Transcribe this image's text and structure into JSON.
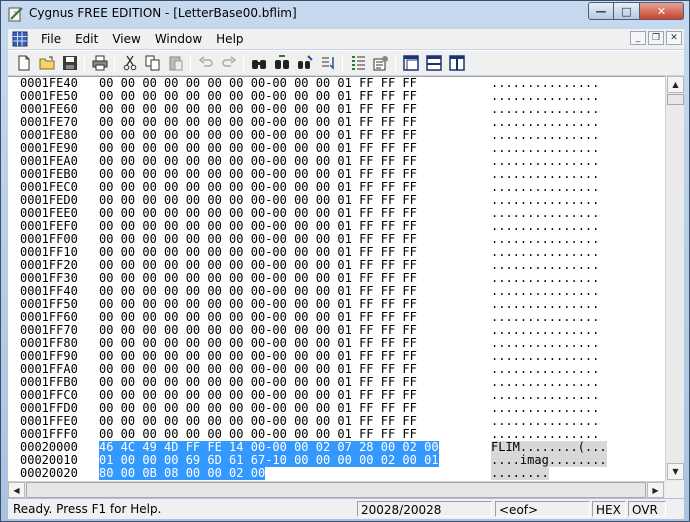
{
  "window": {
    "title": "Cygnus FREE EDITION - [LetterBase00.bflim]",
    "minimize_glyph": "—",
    "maximize_glyph": "□",
    "close_glyph": "✕"
  },
  "menu": {
    "items": [
      "File",
      "Edit",
      "View",
      "Window",
      "Help"
    ]
  },
  "mdi_controls": {
    "minimize": "_",
    "restore": "❐",
    "close": "✕"
  },
  "toolbar": {
    "icons": [
      "new-file-icon",
      "open-folder-icon",
      "save-icon",
      "print-icon",
      "cut-icon",
      "copy-icon",
      "paste-icon",
      "undo-icon",
      "redo-icon",
      "find-icon",
      "find-next-icon",
      "replace-icon",
      "goto-icon",
      "properties-icon",
      "options-icon",
      "tile-horizontal-icon",
      "tile-split-icon",
      "tile-vertical-icon"
    ]
  },
  "hex_rows": [
    {
      "addr": "0001FE40",
      "hex": "00 00 00 00 00 00 00 00-00 00 00 01 FF FF FF",
      "ascii": "..............."
    },
    {
      "addr": "0001FE50",
      "hex": "00 00 00 00 00 00 00 00-00 00 00 01 FF FF FF",
      "ascii": "..............."
    },
    {
      "addr": "0001FE60",
      "hex": "00 00 00 00 00 00 00 00-00 00 00 01 FF FF FF",
      "ascii": "..............."
    },
    {
      "addr": "0001FE70",
      "hex": "00 00 00 00 00 00 00 00-00 00 00 01 FF FF FF",
      "ascii": "..............."
    },
    {
      "addr": "0001FE80",
      "hex": "00 00 00 00 00 00 00 00-00 00 00 01 FF FF FF",
      "ascii": "..............."
    },
    {
      "addr": "0001FE90",
      "hex": "00 00 00 00 00 00 00 00-00 00 00 01 FF FF FF",
      "ascii": "..............."
    },
    {
      "addr": "0001FEA0",
      "hex": "00 00 00 00 00 00 00 00-00 00 00 01 FF FF FF",
      "ascii": "..............."
    },
    {
      "addr": "0001FEB0",
      "hex": "00 00 00 00 00 00 00 00-00 00 00 01 FF FF FF",
      "ascii": "..............."
    },
    {
      "addr": "0001FEC0",
      "hex": "00 00 00 00 00 00 00 00-00 00 00 01 FF FF FF",
      "ascii": "..............."
    },
    {
      "addr": "0001FED0",
      "hex": "00 00 00 00 00 00 00 00-00 00 00 01 FF FF FF",
      "ascii": "..............."
    },
    {
      "addr": "0001FEE0",
      "hex": "00 00 00 00 00 00 00 00-00 00 00 01 FF FF FF",
      "ascii": "..............."
    },
    {
      "addr": "0001FEF0",
      "hex": "00 00 00 00 00 00 00 00-00 00 00 01 FF FF FF",
      "ascii": "..............."
    },
    {
      "addr": "0001FF00",
      "hex": "00 00 00 00 00 00 00 00-00 00 00 01 FF FF FF",
      "ascii": "..............."
    },
    {
      "addr": "0001FF10",
      "hex": "00 00 00 00 00 00 00 00-00 00 00 01 FF FF FF",
      "ascii": "..............."
    },
    {
      "addr": "0001FF20",
      "hex": "00 00 00 00 00 00 00 00-00 00 00 01 FF FF FF",
      "ascii": "..............."
    },
    {
      "addr": "0001FF30",
      "hex": "00 00 00 00 00 00 00 00-00 00 00 01 FF FF FF",
      "ascii": "..............."
    },
    {
      "addr": "0001FF40",
      "hex": "00 00 00 00 00 00 00 00-00 00 00 01 FF FF FF",
      "ascii": "..............."
    },
    {
      "addr": "0001FF50",
      "hex": "00 00 00 00 00 00 00 00-00 00 00 01 FF FF FF",
      "ascii": "..............."
    },
    {
      "addr": "0001FF60",
      "hex": "00 00 00 00 00 00 00 00-00 00 00 01 FF FF FF",
      "ascii": "..............."
    },
    {
      "addr": "0001FF70",
      "hex": "00 00 00 00 00 00 00 00-00 00 00 01 FF FF FF",
      "ascii": "..............."
    },
    {
      "addr": "0001FF80",
      "hex": "00 00 00 00 00 00 00 00-00 00 00 01 FF FF FF",
      "ascii": "..............."
    },
    {
      "addr": "0001FF90",
      "hex": "00 00 00 00 00 00 00 00-00 00 00 01 FF FF FF",
      "ascii": "..............."
    },
    {
      "addr": "0001FFA0",
      "hex": "00 00 00 00 00 00 00 00-00 00 00 01 FF FF FF",
      "ascii": "..............."
    },
    {
      "addr": "0001FFB0",
      "hex": "00 00 00 00 00 00 00 00-00 00 00 01 FF FF FF",
      "ascii": "..............."
    },
    {
      "addr": "0001FFC0",
      "hex": "00 00 00 00 00 00 00 00-00 00 00 01 FF FF FF",
      "ascii": "..............."
    },
    {
      "addr": "0001FFD0",
      "hex": "00 00 00 00 00 00 00 00-00 00 00 01 FF FF FF",
      "ascii": "..............."
    },
    {
      "addr": "0001FFE0",
      "hex": "00 00 00 00 00 00 00 00-00 00 00 01 FF FF FF",
      "ascii": "..............."
    },
    {
      "addr": "0001FFF0",
      "hex": "00 00 00 00 00 00 00 00-00 00 00 01 FF FF FF",
      "ascii": "..............."
    },
    {
      "addr": "00020000",
      "hex": "46 4C 49 4D FF FE 14 00-00 00 02 07 28 00 02 00",
      "ascii": "FLIM........(...",
      "selected": true
    },
    {
      "addr": "00020010",
      "hex": "01 00 00 00 69 6D 61 67-10 00 00 00 00 02 00 01",
      "ascii": "....imag........",
      "selected": true
    },
    {
      "addr": "00020020",
      "hex": "80 00 0B 08 00 00 02 00",
      "ascii": "........",
      "selected": true
    }
  ],
  "scrollbars": {
    "up_arrow": "▲",
    "down_arrow": "▼",
    "left_arrow": "◀",
    "right_arrow": "▶"
  },
  "status": {
    "message": "Ready.  Press F1 for Help.",
    "position": "20028/20028",
    "eof": "<eof>",
    "mode_hex": "HEX",
    "mode_ovr": "OVR"
  }
}
